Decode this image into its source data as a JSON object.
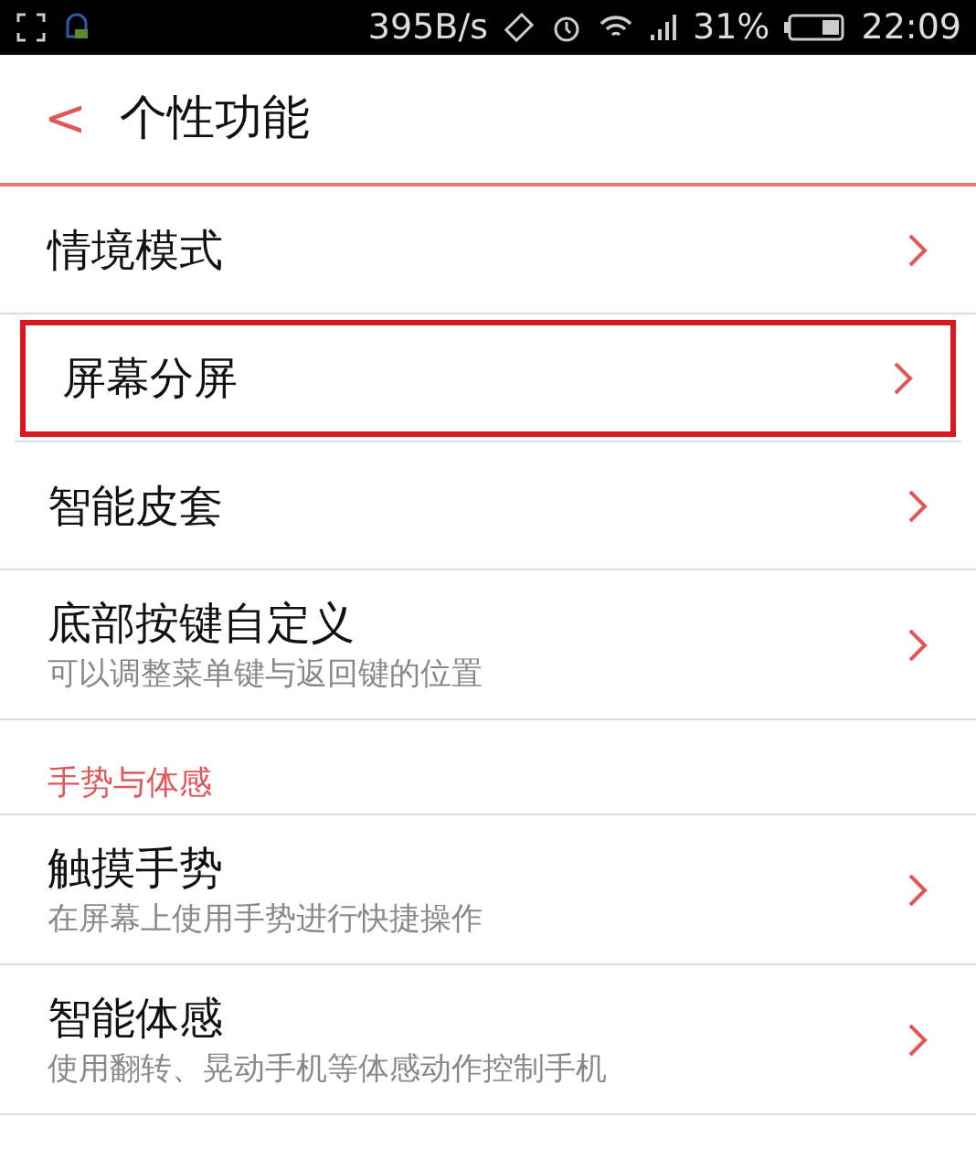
{
  "status_bar": {
    "speed": "395B/s",
    "battery": "31%",
    "time": "22:09"
  },
  "header": {
    "back": "<",
    "title": "个性功能"
  },
  "sections": [
    {
      "items": [
        {
          "title": "情境模式",
          "highlighted": false
        },
        {
          "title": "屏幕分屏",
          "highlighted": true
        },
        {
          "title": "智能皮套",
          "highlighted": false
        },
        {
          "title": "底部按键自定义",
          "subtitle": "可以调整菜单键与返回键的位置",
          "highlighted": false
        }
      ]
    },
    {
      "header": "手势与体感",
      "items": [
        {
          "title": "触摸手势",
          "subtitle": "在屏幕上使用手势进行快捷操作",
          "highlighted": false
        },
        {
          "title": "智能体感",
          "subtitle": "使用翻转、晃动手机等体感动作控制手机",
          "highlighted": false
        }
      ]
    }
  ]
}
